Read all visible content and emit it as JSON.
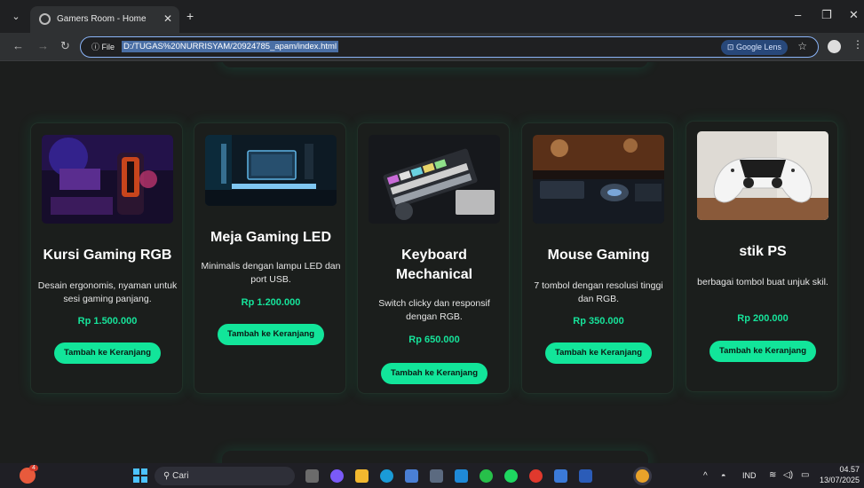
{
  "browser": {
    "tab_title": "Gamers Room - Home",
    "new_tab_symbol": "+",
    "close_symbol": "✕",
    "site_info_label": "File",
    "url": "D:/TUGAS%20NURRISYAM/20924785_apam/index.html",
    "lens_label": "Google Lens",
    "window_controls": [
      "–",
      "❐",
      "✕"
    ]
  },
  "products": [
    {
      "title": "Kursi Gaming RGB",
      "description": "Desain ergonomis, nyaman untuk sesi gaming panjang.",
      "price": "Rp 1.500.000",
      "button": "Tambah ke Keranjang",
      "image_icon": "gaming-chair-photo"
    },
    {
      "title": "Meja Gaming LED",
      "description": "Minimalis dengan lampu LED dan port USB.",
      "price": "Rp 1.200.000",
      "button": "Tambah ke Keranjang",
      "image_icon": "gaming-desk-photo"
    },
    {
      "title": "Keyboard Mechanical",
      "description": "Switch clicky dan responsif dengan RGB.",
      "price": "Rp 650.000",
      "button": "Tambah ke Keranjang",
      "image_icon": "keyboard-photo"
    },
    {
      "title": "Mouse Gaming",
      "description": "7 tombol dengan resolusi tinggi dan RGB.",
      "price": "Rp 350.000",
      "button": "Tambah ke Keranjang",
      "image_icon": "mouse-photo"
    },
    {
      "title": "stik PS",
      "description": "berbagai tombol buat unjuk skil.",
      "price": "Rp 200.000",
      "button": "Tambah ke Keranjang",
      "image_icon": "controller-photo"
    }
  ],
  "taskbar": {
    "search_label": "Cari",
    "language": "IND",
    "time": "04.57",
    "date": "13/07/2025",
    "notification_badge": "4"
  },
  "colors": {
    "accent": "#12e59a",
    "page_bg": "#1c1e1d",
    "card_bg": "#1b1e1c"
  }
}
